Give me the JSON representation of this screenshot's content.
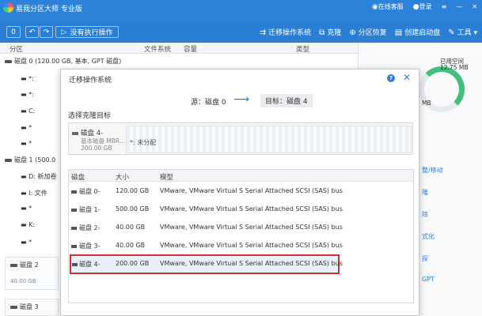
{
  "app": {
    "title": "易我分区大师 专业版"
  },
  "titlebar": {
    "online_service": "在线客服",
    "login": "登录"
  },
  "toolbar": {
    "pending_label": "没有执行操作",
    "pending_count": "0",
    "migrate_os": "迁移操作系统",
    "clone": "克隆",
    "recover": "分区恢复",
    "create_boot": "创建启动盘",
    "tools": "工具"
  },
  "columns": {
    "partition": "分区",
    "filesystem": "文件系统",
    "capacity": "容量",
    "type": "类型"
  },
  "left_list": [
    {
      "label": "磁盘 0 (120.00 GB, 基本, GPT 磁盘)"
    },
    {
      "label": "*:"
    },
    {
      "label": "*:"
    },
    {
      "label": "C:"
    },
    {
      "label": "*"
    },
    {
      "label": "*"
    },
    {
      "label": "磁盘 1 (500.0"
    },
    {
      "label": "D: 新加卷"
    },
    {
      "label": "I: 文件"
    },
    {
      "label": "*"
    },
    {
      "label": "K:"
    },
    {
      "label": "*"
    },
    {
      "label": "磁盘 2"
    },
    {
      "label": "40.00 GB"
    },
    {
      "label": "磁盘 3"
    },
    {
      "label": "40.00 GB"
    }
  ],
  "right_panel": {
    "used_label": "已用空间",
    "used_value": "12.75 MB",
    "pie_label": "MB",
    "action1": "整/移动",
    "action2": "隆",
    "action3": "除",
    "action4": "式化",
    "action5": "探",
    "action6": "GPT"
  },
  "modal": {
    "title": "迁移操作系统",
    "source": "源：磁盘 0",
    "target": "目标：磁盘 4",
    "select_header": "选择克隆目标",
    "card": {
      "name": "磁盘 4-",
      "type": "基本磁盘 MBR...",
      "size": "200.00 GB",
      "unalloc_label": "*: 未分配"
    },
    "table": {
      "headers": [
        "磁盘",
        "大小",
        "模型"
      ],
      "rows": [
        {
          "disk": "磁盘 0-",
          "size": "120.00 GB",
          "model": "VMware,  VMware Virtual S Serial Attached SCSI (SAS) bus"
        },
        {
          "disk": "磁盘 1-",
          "size": "500.00 GB",
          "model": "VMware,  VMware Virtual S Serial Attached SCSI (SAS) bus"
        },
        {
          "disk": "磁盘 2-",
          "size": "40.00 GB",
          "model": "VMware,  VMware Virtual S Serial Attached SCSI (SAS) bus"
        },
        {
          "disk": "磁盘 3-",
          "size": "40.00 GB",
          "model": "VMware,  VMware Virtual S Serial Attached SCSI (SAS) bus"
        },
        {
          "disk": "磁盘 4-",
          "size": "200.00 GB",
          "model": "VMware,  VMware Virtual S Serial Attached SCSI (SAS) bus"
        }
      ]
    }
  }
}
